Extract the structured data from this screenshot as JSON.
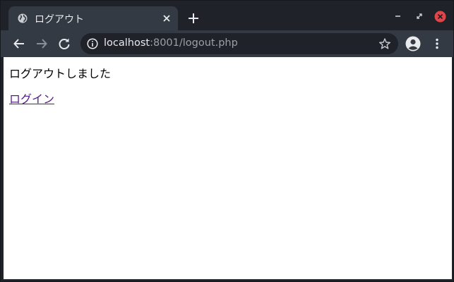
{
  "tab": {
    "title": "ログアウト",
    "favicon": "globe-icon"
  },
  "address_bar": {
    "host": "localhost",
    "path": ":8001/logout.php"
  },
  "page": {
    "message": "ログアウトしました",
    "link_label": "ログイン"
  },
  "colors": {
    "window_bg": "#1f2329",
    "toolbar_bg": "#343a43",
    "close_button": "#e0454a",
    "visited_link": "#551a8b"
  }
}
